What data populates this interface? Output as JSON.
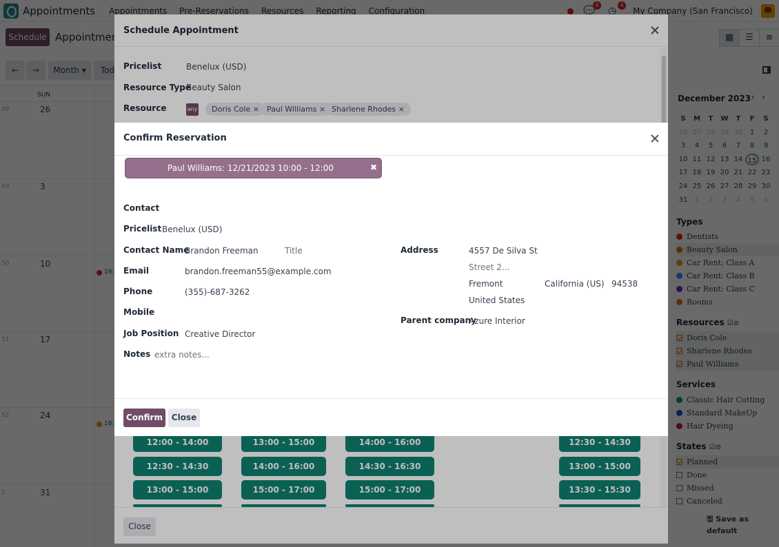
{
  "navbar": {
    "app_name": "Appointments",
    "menu": [
      "Appointments",
      "Pre-Reservations",
      "Resources",
      "Reporting",
      "Configuration"
    ],
    "chat_badge": "4",
    "activity_badge": "4",
    "company": "My Company (San Francisco)"
  },
  "control": {
    "schedule_label": "Schedule",
    "view_title": "Appointments",
    "month_label": "Month",
    "today_label": "Tod"
  },
  "calendar": {
    "dow": "SUN",
    "weeks": [
      {
        "wk": "48",
        "day": "26"
      },
      {
        "wk": "49",
        "day": "3"
      },
      {
        "wk": "50",
        "day": "10"
      },
      {
        "wk": "51",
        "day": "17"
      },
      {
        "wk": "52",
        "day": "24"
      },
      {
        "wk": "1",
        "day": "31"
      }
    ],
    "event_label_w50": "16:",
    "event_label_w52": "16:"
  },
  "sidebar": {
    "month_title": "December 2023",
    "dow": [
      "S",
      "M",
      "T",
      "W",
      "T",
      "F",
      "S"
    ],
    "days": [
      "26",
      "27",
      "28",
      "29",
      "30",
      "1",
      "2",
      "3",
      "4",
      "5",
      "6",
      "7",
      "8",
      "9",
      "10",
      "11",
      "12",
      "13",
      "14",
      "15",
      "16",
      "17",
      "18",
      "19",
      "20",
      "21",
      "22",
      "23",
      "24",
      "25",
      "26",
      "27",
      "28",
      "29",
      "30",
      "31",
      "1",
      "2",
      "3",
      "4",
      "5",
      "6"
    ],
    "types_title": "Types",
    "types": [
      "Dentists",
      "Beauty Salon",
      "Car Rent: Class A",
      "Car Rent: Class B",
      "Car Rent: Class C",
      "Rooms"
    ],
    "type_colors": [
      "#dc2626",
      "#d97706",
      "#d4a017",
      "#3b82f6",
      "#7e22ce",
      "#d97706"
    ],
    "resources_title": "Resources",
    "resources": [
      "Doris Cole",
      "Sharlene Rhodes",
      "Paul Williams"
    ],
    "services_title": "Services",
    "services": [
      "Classic Hair Cutting",
      "Standard MakeUp",
      "Hair Dyeing"
    ],
    "service_colors": [
      "#0d9488",
      "#1d4ed8",
      "#be185d"
    ],
    "states_title": "States",
    "states": [
      "Planned",
      "Done",
      "Missed",
      "Canceled"
    ],
    "save_default": "Save as default"
  },
  "schedule_modal": {
    "title": "Schedule Appointment",
    "pricelist_label": "Pricelist",
    "pricelist_value": "Benelux (USD)",
    "resource_type_label": "Resource Type",
    "resource_type_value": "Beauty Salon",
    "resource_label": "Resource",
    "any_tag": "any",
    "tags": [
      "Doris Cole",
      "Paul Williams",
      "Sharlene Rhodes"
    ],
    "slots_col1": [
      "12:00 - 14:00",
      "12:30 - 14:30",
      "13:00 - 15:00"
    ],
    "slots_col2": [
      "13:00 - 15:00",
      "14:00 - 16:00",
      "15:00 - 17:00"
    ],
    "slots_col3": [
      "14:00 - 16:00",
      "14:30 - 16:30",
      "15:00 - 17:00"
    ],
    "slots_col4": [
      "12:30 - 14:30",
      "13:00 - 15:00",
      "13:30 - 15:30"
    ],
    "close_label": "Close"
  },
  "confirm_modal": {
    "title": "Confirm Reservation",
    "reservation": "Paul Williams: 12/21/2023 10:00 - 12:00",
    "contact_label": "Contact",
    "pricelist_label": "Pricelist",
    "pricelist_value": "Benelux (USD)",
    "contact_name_label": "Contact Name",
    "contact_name_value": "Brandon Freeman",
    "title_placeholder": "Title",
    "email_label": "Email",
    "email_value": "brandon.freeman55@example.com",
    "phone_label": "Phone",
    "phone_value": "(355)-687-3262",
    "mobile_label": "Mobile",
    "job_label": "Job Position",
    "job_value": "Creative Director",
    "notes_label": "Notes",
    "notes_placeholder": "extra notes...",
    "address_label": "Address",
    "street": "4557 De Silva St",
    "street2_placeholder": "Street 2...",
    "city": "Fremont",
    "state": "California (US)",
    "zip": "94538",
    "country": "United States",
    "parent_label": "Parent company",
    "parent_value": "Azure Interior",
    "confirm_label": "Confirm",
    "close_label": "Close"
  }
}
